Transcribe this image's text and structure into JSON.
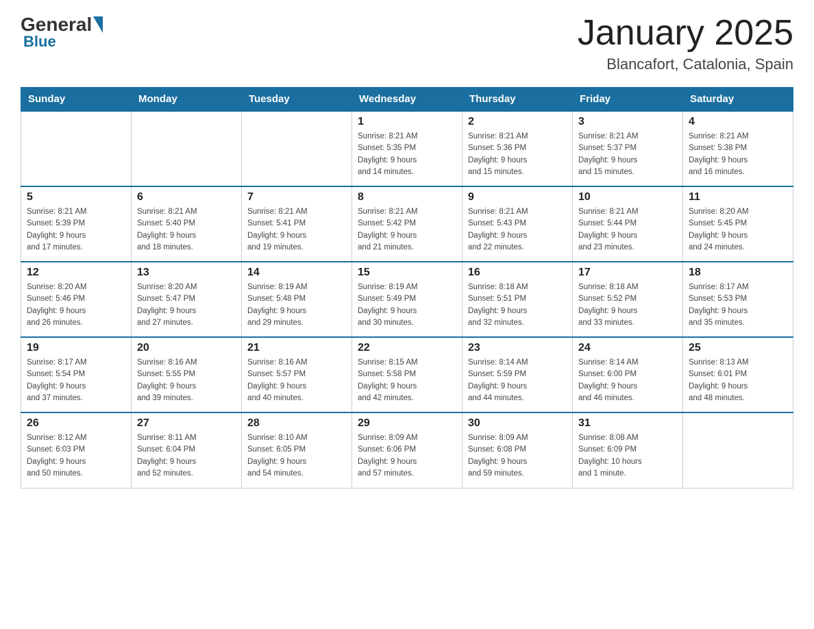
{
  "header": {
    "logo": {
      "general": "General",
      "blue": "Blue"
    },
    "title": "January 2025",
    "location": "Blancafort, Catalonia, Spain"
  },
  "days_of_week": [
    "Sunday",
    "Monday",
    "Tuesday",
    "Wednesday",
    "Thursday",
    "Friday",
    "Saturday"
  ],
  "weeks": [
    [
      {
        "day": "",
        "info": ""
      },
      {
        "day": "",
        "info": ""
      },
      {
        "day": "",
        "info": ""
      },
      {
        "day": "1",
        "info": "Sunrise: 8:21 AM\nSunset: 5:35 PM\nDaylight: 9 hours\nand 14 minutes."
      },
      {
        "day": "2",
        "info": "Sunrise: 8:21 AM\nSunset: 5:36 PM\nDaylight: 9 hours\nand 15 minutes."
      },
      {
        "day": "3",
        "info": "Sunrise: 8:21 AM\nSunset: 5:37 PM\nDaylight: 9 hours\nand 15 minutes."
      },
      {
        "day": "4",
        "info": "Sunrise: 8:21 AM\nSunset: 5:38 PM\nDaylight: 9 hours\nand 16 minutes."
      }
    ],
    [
      {
        "day": "5",
        "info": "Sunrise: 8:21 AM\nSunset: 5:39 PM\nDaylight: 9 hours\nand 17 minutes."
      },
      {
        "day": "6",
        "info": "Sunrise: 8:21 AM\nSunset: 5:40 PM\nDaylight: 9 hours\nand 18 minutes."
      },
      {
        "day": "7",
        "info": "Sunrise: 8:21 AM\nSunset: 5:41 PM\nDaylight: 9 hours\nand 19 minutes."
      },
      {
        "day": "8",
        "info": "Sunrise: 8:21 AM\nSunset: 5:42 PM\nDaylight: 9 hours\nand 21 minutes."
      },
      {
        "day": "9",
        "info": "Sunrise: 8:21 AM\nSunset: 5:43 PM\nDaylight: 9 hours\nand 22 minutes."
      },
      {
        "day": "10",
        "info": "Sunrise: 8:21 AM\nSunset: 5:44 PM\nDaylight: 9 hours\nand 23 minutes."
      },
      {
        "day": "11",
        "info": "Sunrise: 8:20 AM\nSunset: 5:45 PM\nDaylight: 9 hours\nand 24 minutes."
      }
    ],
    [
      {
        "day": "12",
        "info": "Sunrise: 8:20 AM\nSunset: 5:46 PM\nDaylight: 9 hours\nand 26 minutes."
      },
      {
        "day": "13",
        "info": "Sunrise: 8:20 AM\nSunset: 5:47 PM\nDaylight: 9 hours\nand 27 minutes."
      },
      {
        "day": "14",
        "info": "Sunrise: 8:19 AM\nSunset: 5:48 PM\nDaylight: 9 hours\nand 29 minutes."
      },
      {
        "day": "15",
        "info": "Sunrise: 8:19 AM\nSunset: 5:49 PM\nDaylight: 9 hours\nand 30 minutes."
      },
      {
        "day": "16",
        "info": "Sunrise: 8:18 AM\nSunset: 5:51 PM\nDaylight: 9 hours\nand 32 minutes."
      },
      {
        "day": "17",
        "info": "Sunrise: 8:18 AM\nSunset: 5:52 PM\nDaylight: 9 hours\nand 33 minutes."
      },
      {
        "day": "18",
        "info": "Sunrise: 8:17 AM\nSunset: 5:53 PM\nDaylight: 9 hours\nand 35 minutes."
      }
    ],
    [
      {
        "day": "19",
        "info": "Sunrise: 8:17 AM\nSunset: 5:54 PM\nDaylight: 9 hours\nand 37 minutes."
      },
      {
        "day": "20",
        "info": "Sunrise: 8:16 AM\nSunset: 5:55 PM\nDaylight: 9 hours\nand 39 minutes."
      },
      {
        "day": "21",
        "info": "Sunrise: 8:16 AM\nSunset: 5:57 PM\nDaylight: 9 hours\nand 40 minutes."
      },
      {
        "day": "22",
        "info": "Sunrise: 8:15 AM\nSunset: 5:58 PM\nDaylight: 9 hours\nand 42 minutes."
      },
      {
        "day": "23",
        "info": "Sunrise: 8:14 AM\nSunset: 5:59 PM\nDaylight: 9 hours\nand 44 minutes."
      },
      {
        "day": "24",
        "info": "Sunrise: 8:14 AM\nSunset: 6:00 PM\nDaylight: 9 hours\nand 46 minutes."
      },
      {
        "day": "25",
        "info": "Sunrise: 8:13 AM\nSunset: 6:01 PM\nDaylight: 9 hours\nand 48 minutes."
      }
    ],
    [
      {
        "day": "26",
        "info": "Sunrise: 8:12 AM\nSunset: 6:03 PM\nDaylight: 9 hours\nand 50 minutes."
      },
      {
        "day": "27",
        "info": "Sunrise: 8:11 AM\nSunset: 6:04 PM\nDaylight: 9 hours\nand 52 minutes."
      },
      {
        "day": "28",
        "info": "Sunrise: 8:10 AM\nSunset: 6:05 PM\nDaylight: 9 hours\nand 54 minutes."
      },
      {
        "day": "29",
        "info": "Sunrise: 8:09 AM\nSunset: 6:06 PM\nDaylight: 9 hours\nand 57 minutes."
      },
      {
        "day": "30",
        "info": "Sunrise: 8:09 AM\nSunset: 6:08 PM\nDaylight: 9 hours\nand 59 minutes."
      },
      {
        "day": "31",
        "info": "Sunrise: 8:08 AM\nSunset: 6:09 PM\nDaylight: 10 hours\nand 1 minute."
      },
      {
        "day": "",
        "info": ""
      }
    ]
  ]
}
